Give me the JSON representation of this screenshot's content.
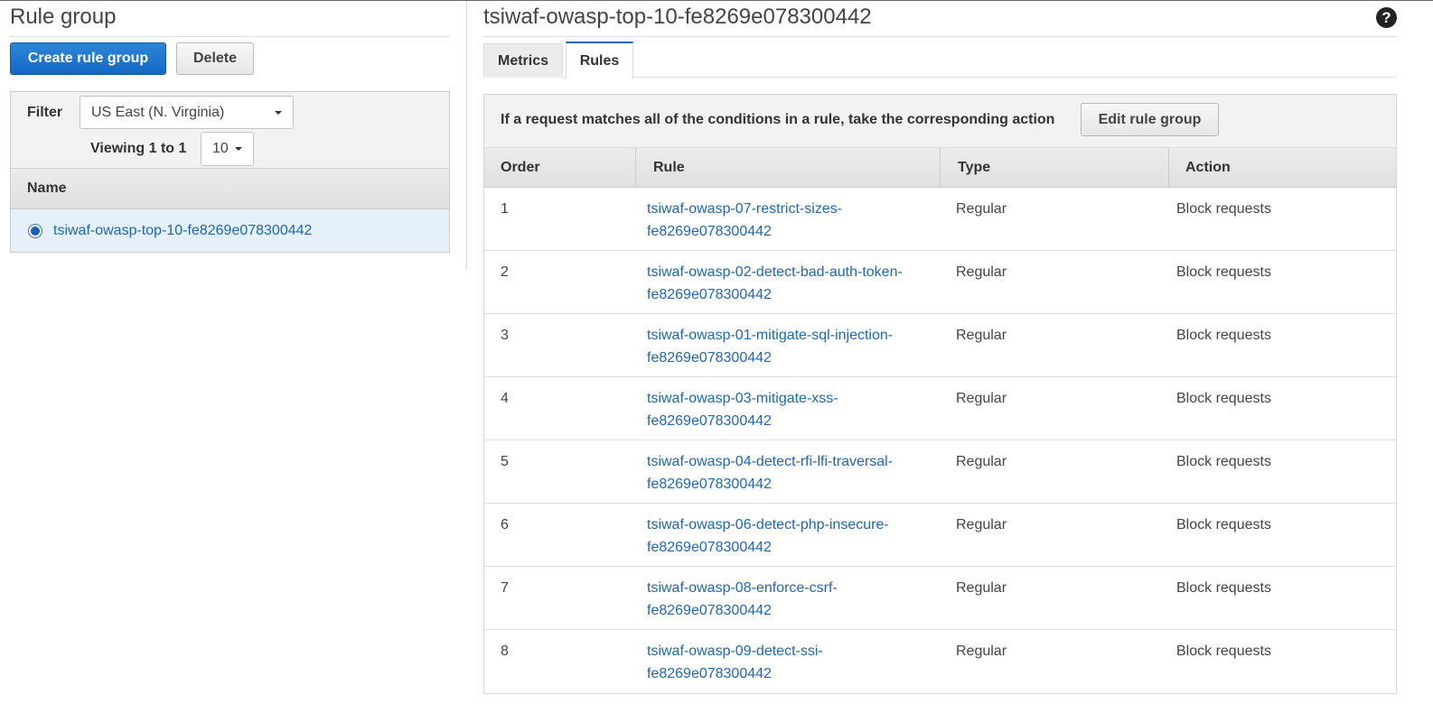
{
  "left": {
    "title": "Rule group",
    "create_button": "Create rule group",
    "delete_button": "Delete",
    "filter_label": "Filter",
    "region": "US East (N. Virginia)",
    "viewing": "Viewing 1 to 1",
    "page_size": "10",
    "name_header": "Name",
    "groups": [
      {
        "name": "tsiwaf-owasp-top-10-fe8269e078300442",
        "selected": true
      }
    ]
  },
  "right": {
    "title": "tsiwaf-owasp-top-10-fe8269e078300442",
    "help_icon": "question-circle-icon",
    "tabs": [
      {
        "label": "Metrics",
        "active": false
      },
      {
        "label": "Rules",
        "active": true
      }
    ],
    "description": "If a request matches all of the conditions in a rule, take the corresponding action",
    "edit_button": "Edit rule group",
    "columns": [
      "Order",
      "Rule",
      "Type",
      "Action"
    ],
    "rules": [
      {
        "order": "1",
        "rule": "tsiwaf-owasp-07-restrict-sizes-fe8269e078300442",
        "type": "Regular",
        "action": "Block requests"
      },
      {
        "order": "2",
        "rule": "tsiwaf-owasp-02-detect-bad-auth-token-fe8269e078300442",
        "type": "Regular",
        "action": "Block requests"
      },
      {
        "order": "3",
        "rule": "tsiwaf-owasp-01-mitigate-sql-injection-fe8269e078300442",
        "type": "Regular",
        "action": "Block requests"
      },
      {
        "order": "4",
        "rule": "tsiwaf-owasp-03-mitigate-xss-fe8269e078300442",
        "type": "Regular",
        "action": "Block requests"
      },
      {
        "order": "5",
        "rule": "tsiwaf-owasp-04-detect-rfi-lfi-traversal-fe8269e078300442",
        "type": "Regular",
        "action": "Block requests"
      },
      {
        "order": "6",
        "rule": "tsiwaf-owasp-06-detect-php-insecure-fe8269e078300442",
        "type": "Regular",
        "action": "Block requests"
      },
      {
        "order": "7",
        "rule": "tsiwaf-owasp-08-enforce-csrf-fe8269e078300442",
        "type": "Regular",
        "action": "Block requests"
      },
      {
        "order": "8",
        "rule": "tsiwaf-owasp-09-detect-ssi-fe8269e078300442",
        "type": "Regular",
        "action": "Block requests"
      }
    ]
  },
  "colors": {
    "primary_button": "#1467c4",
    "link": "#1d67b5",
    "selected_row": "#e6f0fa",
    "active_tab_border": "#1a67c0"
  }
}
